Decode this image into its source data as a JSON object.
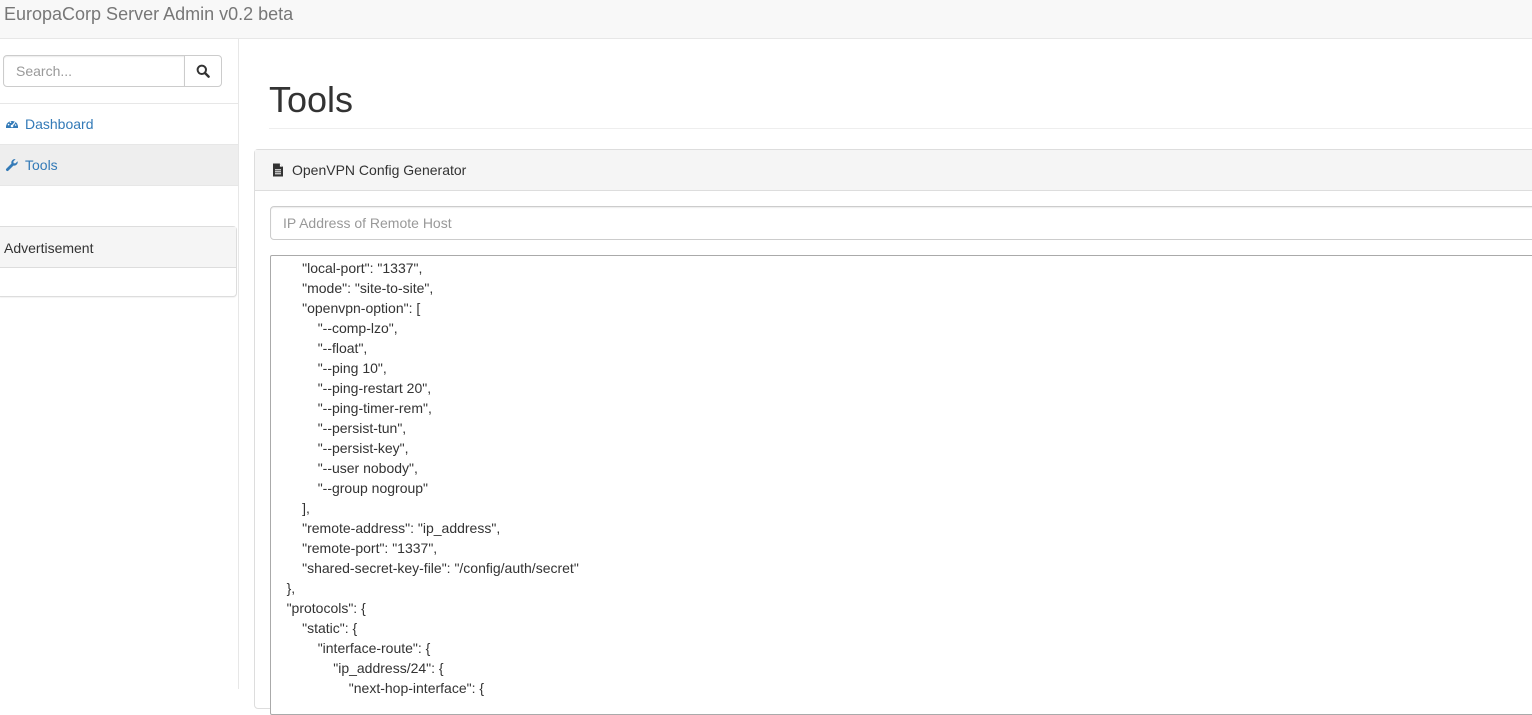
{
  "app": {
    "brand": "EuropaCorp Server Admin v0.2 beta"
  },
  "sidebar": {
    "search": {
      "placeholder": "Search...",
      "icon": "search-icon"
    },
    "items": [
      {
        "label": "Dashboard",
        "icon": "dashboard-icon",
        "active": false
      },
      {
        "label": "Tools",
        "icon": "wrench-icon",
        "active": true
      }
    ],
    "advertisement": {
      "heading": "Advertisement"
    }
  },
  "main": {
    "title": "Tools",
    "panel": {
      "heading": "OpenVPN Config Generator",
      "icon": "file-icon",
      "ip_placeholder": "IP Address of Remote Host",
      "config_text": "\t\t\"local-port\": \"1337\",\n\t\t\"mode\": \"site-to-site\",\n\t\t\"openvpn-option\": [\n\t\t\t\"--comp-lzo\",\n\t\t\t\"--float\",\n\t\t\t\"--ping 10\",\n\t\t\t\"--ping-restart 20\",\n\t\t\t\"--ping-timer-rem\",\n\t\t\t\"--persist-tun\",\n\t\t\t\"--persist-key\",\n\t\t\t\"--user nobody\",\n\t\t\t\"--group nogroup\"\n\t\t],\n\t\t\"remote-address\": \"ip_address\",\n\t\t\"remote-port\": \"1337\",\n\t\t\"shared-secret-key-file\": \"/config/auth/secret\"\n\t},\n\t\"protocols\": {\n\t\t\"static\": {\n\t\t\t\"interface-route\": {\n\t\t\t\t\"ip_address/24\": {\n\t\t\t\t\t\"next-hop-interface\": {"
    }
  },
  "colors": {
    "link": "#337ab7",
    "topbar_bg": "#f8f8f8",
    "panel_heading_bg": "#f5f5f5",
    "active_nav_bg": "#eeeeee"
  }
}
